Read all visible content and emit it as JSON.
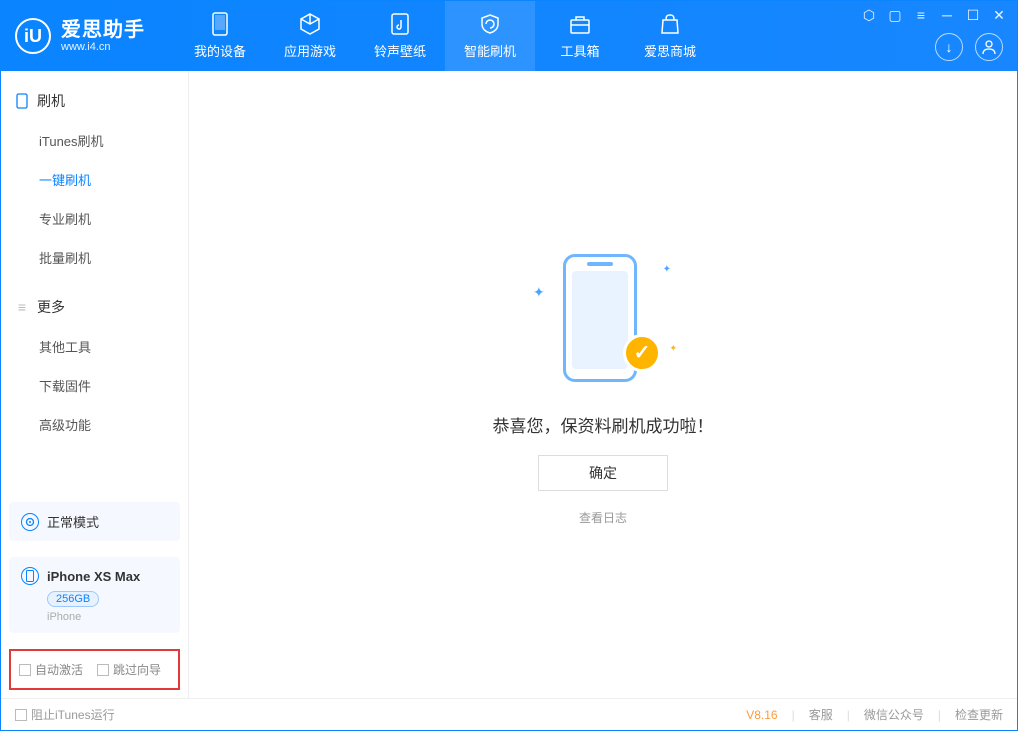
{
  "brand": {
    "title": "爱思助手",
    "url": "www.i4.cn",
    "logo_letter": "iU"
  },
  "tabs": [
    {
      "label": "我的设备"
    },
    {
      "label": "应用游戏"
    },
    {
      "label": "铃声壁纸"
    },
    {
      "label": "智能刷机"
    },
    {
      "label": "工具箱"
    },
    {
      "label": "爱思商城"
    }
  ],
  "sidebar": {
    "section1": {
      "title": "刷机",
      "items": [
        "iTunes刷机",
        "一键刷机",
        "专业刷机",
        "批量刷机"
      ],
      "active_index": 1
    },
    "section2": {
      "title": "更多",
      "items": [
        "其他工具",
        "下载固件",
        "高级功能"
      ]
    }
  },
  "mode_box": {
    "label": "正常模式"
  },
  "device": {
    "name": "iPhone XS Max",
    "storage": "256GB",
    "type": "iPhone"
  },
  "options": {
    "auto_activate": "自动激活",
    "skip_guide": "跳过向导"
  },
  "main": {
    "message": "恭喜您，保资料刷机成功啦！",
    "ok": "确定",
    "view_log": "查看日志"
  },
  "footer": {
    "block_itunes": "阻止iTunes运行",
    "version": "V8.16",
    "links": [
      "客服",
      "微信公众号",
      "检查更新"
    ]
  }
}
